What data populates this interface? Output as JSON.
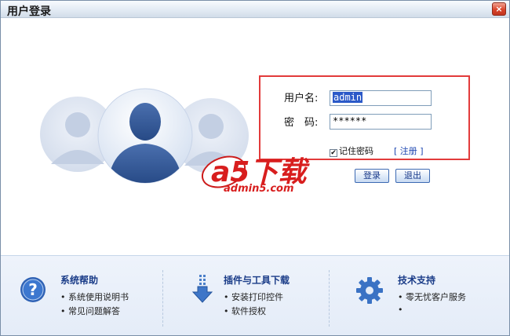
{
  "window": {
    "title": "用户登录",
    "close_label": "×"
  },
  "login": {
    "username_label": "用户名:",
    "username_value": "admin",
    "password_label": "密　码:",
    "password_value": "******",
    "remember_label": "记住密码",
    "register_label": "[ 注册 ]",
    "login_button": "登录",
    "exit_button": "退出"
  },
  "watermark": {
    "brand": "a5下载",
    "url": "admin5.com"
  },
  "footer": {
    "help": {
      "title": "系统帮助",
      "items": [
        "系统使用说明书",
        "常见问题解答"
      ]
    },
    "downloads": {
      "title": "插件与工具下载",
      "items": [
        "安装打印控件",
        "软件授权"
      ]
    },
    "support": {
      "title": "技术支持",
      "items": [
        "零无忧客户服务",
        ""
      ]
    }
  },
  "colors": {
    "accent_red": "#e23b3b",
    "link_blue": "#1a44b0",
    "avatar_blue": "#2d5596"
  }
}
